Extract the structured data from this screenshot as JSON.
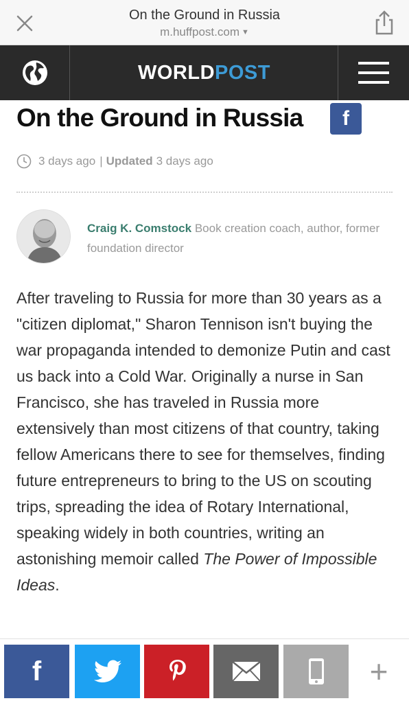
{
  "browser": {
    "title": "On the Ground in Russia",
    "url": "m.huffpost.com",
    "icons": {
      "close": "close-icon",
      "share": "share-icon",
      "dropdown": "chevron-down-icon"
    }
  },
  "site": {
    "logo_part1": "WORLD",
    "logo_part2": "POST",
    "icons": {
      "globe": "globe-icon",
      "menu": "hamburger-menu-icon"
    }
  },
  "article": {
    "headline": "On the Ground in Russia",
    "facebook_badge": "f",
    "time_posted": "3 days ago",
    "time_separator": "|",
    "updated_label": "Updated",
    "time_updated": "3 days ago",
    "author": {
      "name": "Craig K. Comstock",
      "bio": "Book creation coach, author, former foundation director"
    },
    "body_text": "After traveling to Russia for more than 30 years as a \"citizen diplomat,\" Sharon Tennison isn't buying the war propaganda intended to demonize Putin and cast us back into a Cold War. Originally a nurse in San Francisco, she has traveled in Russia more extensively than most citizens of that country, taking fellow Americans there to see for themselves, finding future entrepreneurs to bring to the US on scouting trips, spreading the idea of Rotary International, speaking widely in both countries, writing an astonishing memoir called ",
    "book_title": "The Power of Impossible Ideas",
    "body_end": "."
  },
  "share_bar": {
    "facebook_label": "f",
    "more_label": "+",
    "icons": [
      "facebook-icon",
      "twitter-icon",
      "pinterest-icon",
      "mail-icon",
      "phone-icon",
      "plus-icon"
    ],
    "colors": {
      "facebook": "#3b5998",
      "twitter": "#1da1f2",
      "pinterest": "#cb2027",
      "mail": "#666666",
      "sms": "#aaaaaa"
    }
  },
  "colors": {
    "header_bg": "#2a2a2a",
    "logo_accent": "#3d9bd6",
    "author_name": "#3a7d6e"
  }
}
